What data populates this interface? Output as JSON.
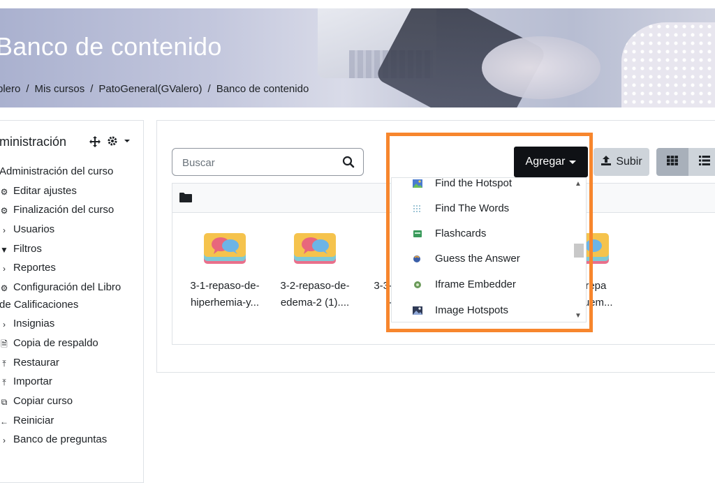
{
  "header": {
    "title": "Banco de contenido",
    "breadcrumb": [
      "plero",
      "Mis cursos",
      "PatoGeneral(GValero)",
      "Banco de contenido"
    ]
  },
  "sidebar": {
    "title": "ministración",
    "items": [
      {
        "label": "Administración del curso",
        "icon": "none"
      },
      {
        "label": "Editar ajustes",
        "icon": "gear-icon"
      },
      {
        "label": "Finalización del curso",
        "icon": "gear-icon"
      },
      {
        "label": "Usuarios",
        "icon": "chevron-right-icon"
      },
      {
        "label": "Filtros",
        "icon": "filter-icon"
      },
      {
        "label": "Reportes",
        "icon": "chevron-right-icon"
      },
      {
        "label": "Configuración del Libro",
        "label2": "de Calificaciones",
        "icon": "gear-icon"
      },
      {
        "label": "Insignias",
        "icon": "chevron-right-icon"
      },
      {
        "label": "Copia de respaldo",
        "icon": "file-icon"
      },
      {
        "label": "Restaurar",
        "icon": "upload-icon"
      },
      {
        "label": "Importar",
        "icon": "upload-icon"
      },
      {
        "label": "Copiar curso",
        "icon": "copy-icon"
      },
      {
        "label": "Reiniciar",
        "icon": "arrow-left-icon"
      },
      {
        "label": "Banco de preguntas",
        "icon": "chevron-right-icon"
      }
    ]
  },
  "toolbar": {
    "search_placeholder": "Buscar",
    "add_label": "Agregar",
    "upload_label": "Subir"
  },
  "files": [
    {
      "line1": "3-1-repaso-de-",
      "line2": "hiperhemia-y..."
    },
    {
      "line1": "3-2-repaso-de-",
      "line2": "edema-2 (1)...."
    },
    {
      "line1": "3-3-",
      "line2": "-"
    },
    {
      "line1": "-7-repa",
      "line2": "squem..."
    }
  ],
  "dropdown": {
    "items": [
      {
        "label": "Find the Hotspot",
        "icon": "image-icon"
      },
      {
        "label": "Find The Words",
        "icon": "grid-dots-icon"
      },
      {
        "label": "Flashcards",
        "icon": "card-icon"
      },
      {
        "label": "Guess the Answer",
        "icon": "guess-icon"
      },
      {
        "label": "Iframe Embedder",
        "icon": "embed-icon"
      },
      {
        "label": "Image Hotspots",
        "icon": "image-icon"
      }
    ]
  },
  "colors": {
    "highlight": "#f7862d",
    "add_button": "#0f1115",
    "subir_button": "#ced4da"
  }
}
